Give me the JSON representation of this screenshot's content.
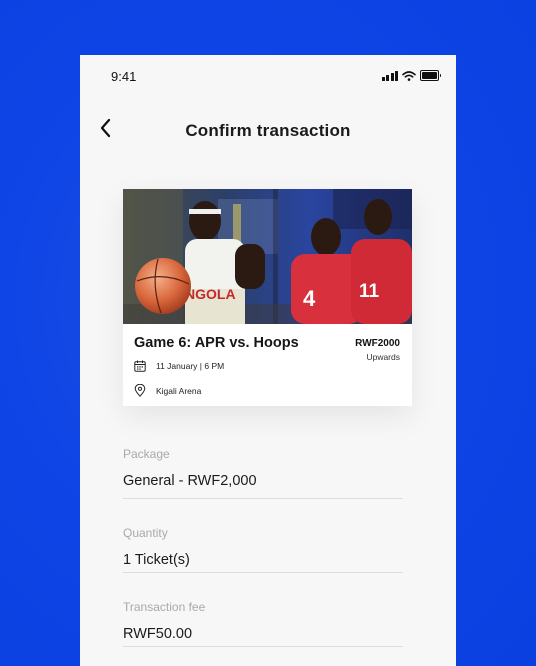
{
  "status_bar": {
    "time": "9:41"
  },
  "header": {
    "title": "Confirm transaction"
  },
  "event": {
    "title": "Game 6: APR vs. Hoops",
    "price": "RWF2000",
    "price_note": "Upwards",
    "date": "11 January | 6 PM",
    "location": "Kigali Arena",
    "jersey_text": "NGOLA"
  },
  "form": {
    "package": {
      "label": "Package",
      "value": "General - RWF2,000"
    },
    "quantity": {
      "label": "Quantity",
      "value": "1 Ticket(s)"
    },
    "fee": {
      "label": "Transaction fee",
      "value": "RWF50.00"
    }
  },
  "colors": {
    "background": "#0a3fe0",
    "screen": "#f7f7f7",
    "jersey_red": "#d8303c"
  },
  "icons": [
    "signal-icon",
    "wifi-icon",
    "battery-icon",
    "back-chevron-icon",
    "calendar-icon",
    "location-pin-icon"
  ]
}
